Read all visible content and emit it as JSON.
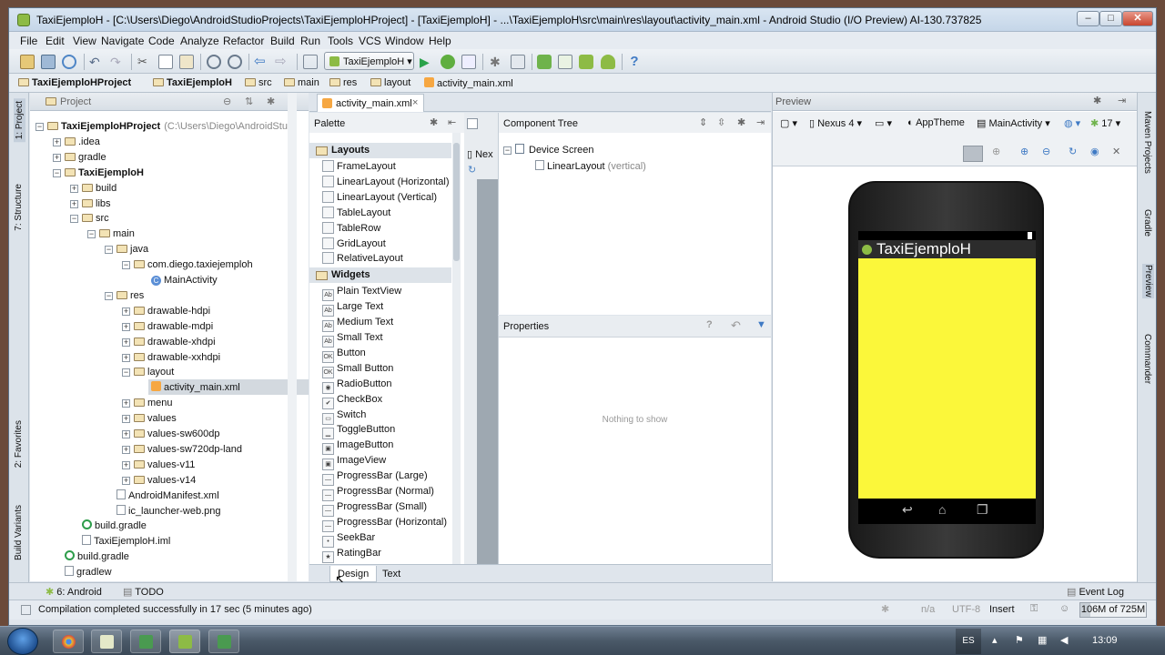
{
  "window": {
    "title": "TaxiEjemploH - [C:\\Users\\Diego\\AndroidStudioProjects\\TaxiEjemploHProject] - [TaxiEjemploH] - ...\\TaxiEjemploH\\src\\main\\res\\layout\\activity_main.xml - Android Studio (I/O Preview) AI-130.737825",
    "min": "–",
    "max": "□",
    "close": "✕"
  },
  "menu": [
    "File",
    "Edit",
    "View",
    "Navigate",
    "Code",
    "Analyze",
    "Refactor",
    "Build",
    "Run",
    "Tools",
    "VCS",
    "Window",
    "Help"
  ],
  "toolbar": {
    "run_config": "TaxiEjemploH"
  },
  "breadcrumbs": [
    "TaxiEjemploHProject",
    "TaxiEjemploH",
    "src",
    "main",
    "res",
    "layout",
    "activity_main.xml"
  ],
  "left_strip": {
    "project": "1: Project",
    "structure": "7: Structure",
    "favorites": "2: Favorites",
    "build_variants": "Build Variants"
  },
  "right_strip": {
    "maven": "Maven Projects",
    "gradle": "Gradle",
    "preview": "Preview",
    "commander": "Commander"
  },
  "project_panel": {
    "title": "Project",
    "tree": [
      {
        "label": "TaxiEjemploHProject",
        "extra": "(C:\\Users\\Diego\\AndroidStudi",
        "toggle": "−",
        "icon": "folder",
        "level": 0,
        "bold": true
      },
      {
        "label": ".idea",
        "toggle": "+",
        "icon": "folder",
        "level": 1
      },
      {
        "label": "gradle",
        "toggle": "+",
        "icon": "folder",
        "level": 1
      },
      {
        "label": "TaxiEjemploH",
        "toggle": "−",
        "icon": "folder",
        "level": 1,
        "bold": true
      },
      {
        "label": "build",
        "toggle": "+",
        "icon": "folder",
        "level": 2
      },
      {
        "label": "libs",
        "toggle": "+",
        "icon": "folder",
        "level": 2
      },
      {
        "label": "src",
        "toggle": "−",
        "icon": "folder",
        "level": 2
      },
      {
        "label": "main",
        "toggle": "−",
        "icon": "folder",
        "level": 3
      },
      {
        "label": "java",
        "toggle": "−",
        "icon": "folder",
        "level": 4
      },
      {
        "label": "com.diego.taxiejemploh",
        "toggle": "−",
        "icon": "folder",
        "level": 5
      },
      {
        "label": "MainActivity",
        "toggle": "",
        "icon": "class",
        "level": 6
      },
      {
        "label": "res",
        "toggle": "−",
        "icon": "folder",
        "level": 4
      },
      {
        "label": "drawable-hdpi",
        "toggle": "+",
        "icon": "folder",
        "level": 5
      },
      {
        "label": "drawable-mdpi",
        "toggle": "+",
        "icon": "folder",
        "level": 5
      },
      {
        "label": "drawable-xhdpi",
        "toggle": "+",
        "icon": "folder",
        "level": 5
      },
      {
        "label": "drawable-xxhdpi",
        "toggle": "+",
        "icon": "folder",
        "level": 5
      },
      {
        "label": "layout",
        "toggle": "−",
        "icon": "folder",
        "level": 5
      },
      {
        "label": "activity_main.xml",
        "toggle": "",
        "icon": "xml",
        "level": 6
      },
      {
        "label": "menu",
        "toggle": "+",
        "icon": "folder",
        "level": 5
      },
      {
        "label": "values",
        "toggle": "+",
        "icon": "folder",
        "level": 5
      },
      {
        "label": "values-sw600dp",
        "toggle": "+",
        "icon": "folder",
        "level": 5
      },
      {
        "label": "values-sw720dp-land",
        "toggle": "+",
        "icon": "folder",
        "level": 5
      },
      {
        "label": "values-v11",
        "toggle": "+",
        "icon": "folder",
        "level": 5
      },
      {
        "label": "values-v14",
        "toggle": "+",
        "icon": "folder",
        "level": 5
      },
      {
        "label": "AndroidManifest.xml",
        "toggle": "",
        "icon": "file",
        "level": 4
      },
      {
        "label": "ic_launcher-web.png",
        "toggle": "",
        "icon": "file",
        "level": 4
      },
      {
        "label": "build.gradle",
        "toggle": "",
        "icon": "gradle",
        "level": 2
      },
      {
        "label": "TaxiEjemploH.iml",
        "toggle": "",
        "icon": "file",
        "level": 2
      },
      {
        "label": "build.gradle",
        "toggle": "",
        "icon": "gradle",
        "level": 1
      },
      {
        "label": "gradlew",
        "toggle": "",
        "icon": "file",
        "level": 1
      }
    ]
  },
  "editor": {
    "tab": "activity_main.xml",
    "tab_close": "×"
  },
  "palette": {
    "title": "Palette",
    "layouts_title": "Layouts",
    "layouts": [
      "FrameLayout",
      "LinearLayout (Horizontal)",
      "LinearLayout (Vertical)",
      "TableLayout",
      "TableRow",
      "GridLayout",
      "RelativeLayout"
    ],
    "widgets_title": "Widgets",
    "widgets": [
      {
        "label": "Plain TextView",
        "icon": "Ab"
      },
      {
        "label": "Large Text",
        "icon": "Ab"
      },
      {
        "label": "Medium Text",
        "icon": "Ab"
      },
      {
        "label": "Small Text",
        "icon": "Ab"
      },
      {
        "label": "Button",
        "icon": "OK"
      },
      {
        "label": "Small Button",
        "icon": "OK"
      },
      {
        "label": "RadioButton",
        "icon": "◉"
      },
      {
        "label": "CheckBox",
        "icon": "✔"
      },
      {
        "label": "Switch",
        "icon": "▭"
      },
      {
        "label": "ToggleButton",
        "icon": "▁"
      },
      {
        "label": "ImageButton",
        "icon": "▣"
      },
      {
        "label": "ImageView",
        "icon": "▣"
      },
      {
        "label": "ProgressBar (Large)",
        "icon": "—"
      },
      {
        "label": "ProgressBar (Normal)",
        "icon": "—"
      },
      {
        "label": "ProgressBar (Small)",
        "icon": "—"
      },
      {
        "label": "ProgressBar (Horizontal)",
        "icon": "—"
      },
      {
        "label": "SeekBar",
        "icon": "•"
      },
      {
        "label": "RatingBar",
        "icon": "★"
      }
    ]
  },
  "canvas": {
    "device": "Nex"
  },
  "component_tree": {
    "title": "Component Tree",
    "root": "Device Screen",
    "child": "LinearLayout",
    "child_extra": "(vertical)"
  },
  "properties": {
    "title": "Properties",
    "empty": "Nothing to show",
    "help": "?",
    "undo": "↶",
    "filter": "▼"
  },
  "design_tabs": {
    "design": "Design",
    "text": "Text"
  },
  "preview": {
    "title": "Preview",
    "device": "Nexus 4",
    "theme": "AppTheme",
    "activity": "MainActivity",
    "api": "17",
    "app_title": "TaxiEjemploH",
    "content_color": "#fbf73a"
  },
  "tool_tabs": {
    "android": "6: Android",
    "todo": "TODO",
    "event_log": "Event Log"
  },
  "status": {
    "message": "Compilation completed successfully in 17 sec (5 minutes ago)",
    "na": "n/a",
    "encoding": "UTF-8",
    "insert": "Insert",
    "memory": "106M of 725M"
  },
  "taskbar": {
    "lang": "ES",
    "time": "13:09"
  }
}
